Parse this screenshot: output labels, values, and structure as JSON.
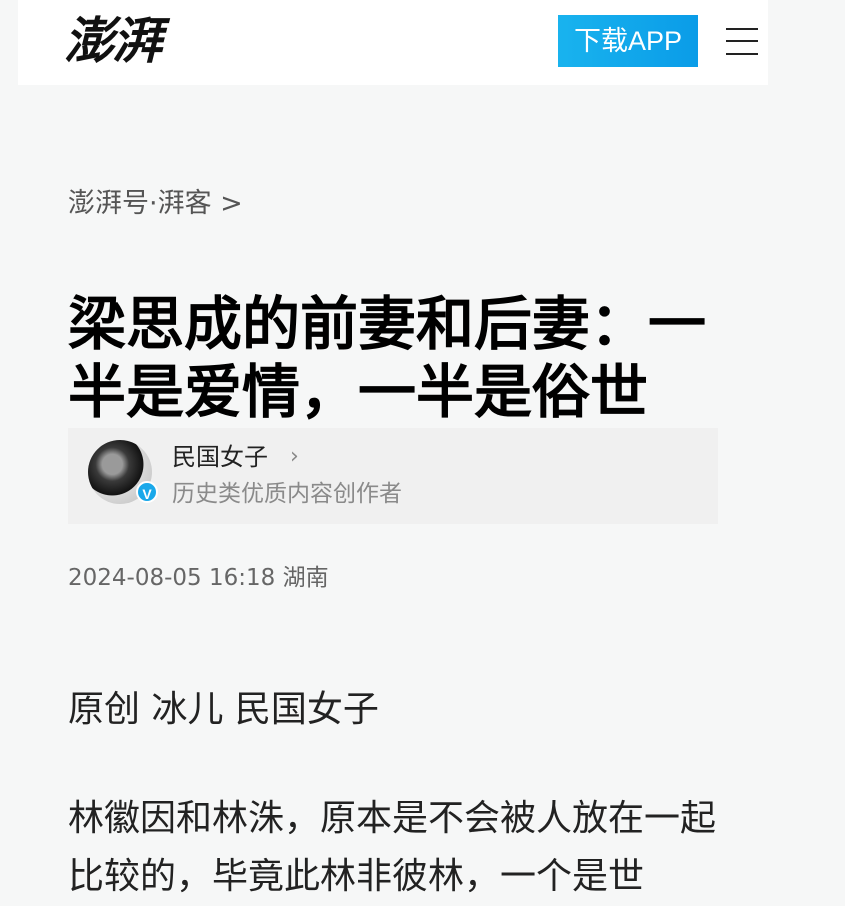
{
  "header": {
    "logo_text": "澎湃",
    "download_label": "下载APP",
    "menu_icon": "menu-icon",
    "accent_color": "#19b3ee"
  },
  "breadcrumb": "澎湃号·湃客 >",
  "article": {
    "title": "梁思成的前妻和后妻：一半是爱情，一半是俗世",
    "author": {
      "name": "民国女子",
      "description": "历史类优质内容创作者",
      "verified_mark": "V"
    },
    "meta": "2024-08-05 16:18  湖南",
    "byline": "原创 冰儿 民国女子",
    "paragraph": "林徽因和林洙，原本是不会被人放在一起比较的，毕竟此林非彼林，一个是世"
  }
}
